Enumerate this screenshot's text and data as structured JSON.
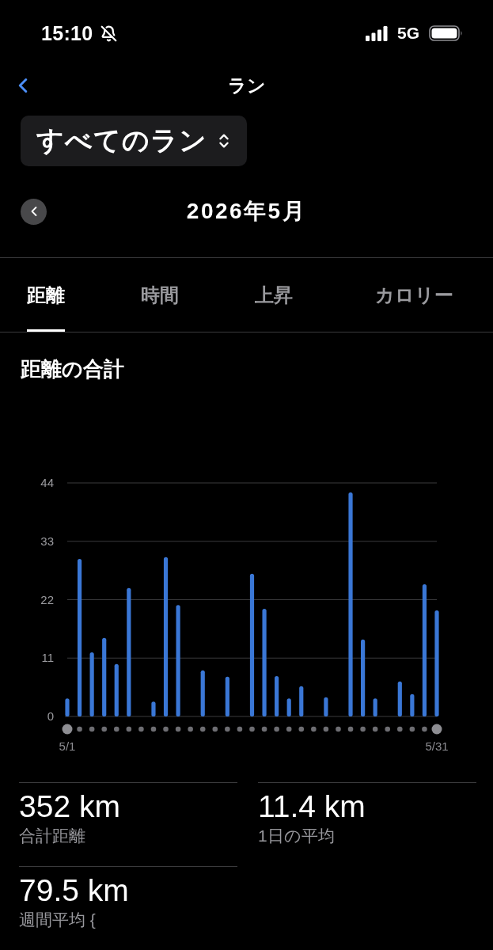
{
  "status_bar": {
    "time": "15:10",
    "network": "5G"
  },
  "nav": {
    "title": "ラン"
  },
  "filter": {
    "label": "すべてのラン"
  },
  "period": {
    "label": "2026年5月"
  },
  "tabs": [
    {
      "label": "距離",
      "selected": true
    },
    {
      "label": "時間",
      "selected": false
    },
    {
      "label": "上昇",
      "selected": false
    },
    {
      "label": "カロリー",
      "selected": false
    }
  ],
  "distance_total": {
    "chart_data": {
      "type": "bar",
      "title": "距離の合計",
      "categories": [
        "5/1",
        null,
        null,
        null,
        null,
        null,
        null,
        null,
        null,
        null,
        null,
        null,
        null,
        null,
        null,
        null,
        null,
        null,
        null,
        null,
        null,
        null,
        null,
        null,
        null,
        null,
        null,
        null,
        null,
        null,
        "5/31"
      ],
      "values": [
        3.4,
        29.7,
        12.1,
        14.8,
        9.9,
        24.2,
        0,
        2.8,
        30.0,
        21.0,
        0,
        8.7,
        0,
        7.5,
        0,
        26.9,
        20.3,
        7.6,
        3.4,
        5.7,
        0,
        3.6,
        0,
        42.2,
        14.5,
        3.4,
        0,
        6.6,
        4.2,
        24.9,
        20.0
      ],
      "ylim": [
        0,
        44
      ],
      "yticks": [
        0,
        11,
        22,
        33,
        44
      ],
      "grid": true
    }
  },
  "stats": [
    {
      "value": "352 km",
      "label": "合計距離"
    },
    {
      "value": "11.4 km",
      "label": "1日の平均"
    },
    {
      "value": "79.5 km",
      "label": "週間平均 {"
    }
  ]
}
